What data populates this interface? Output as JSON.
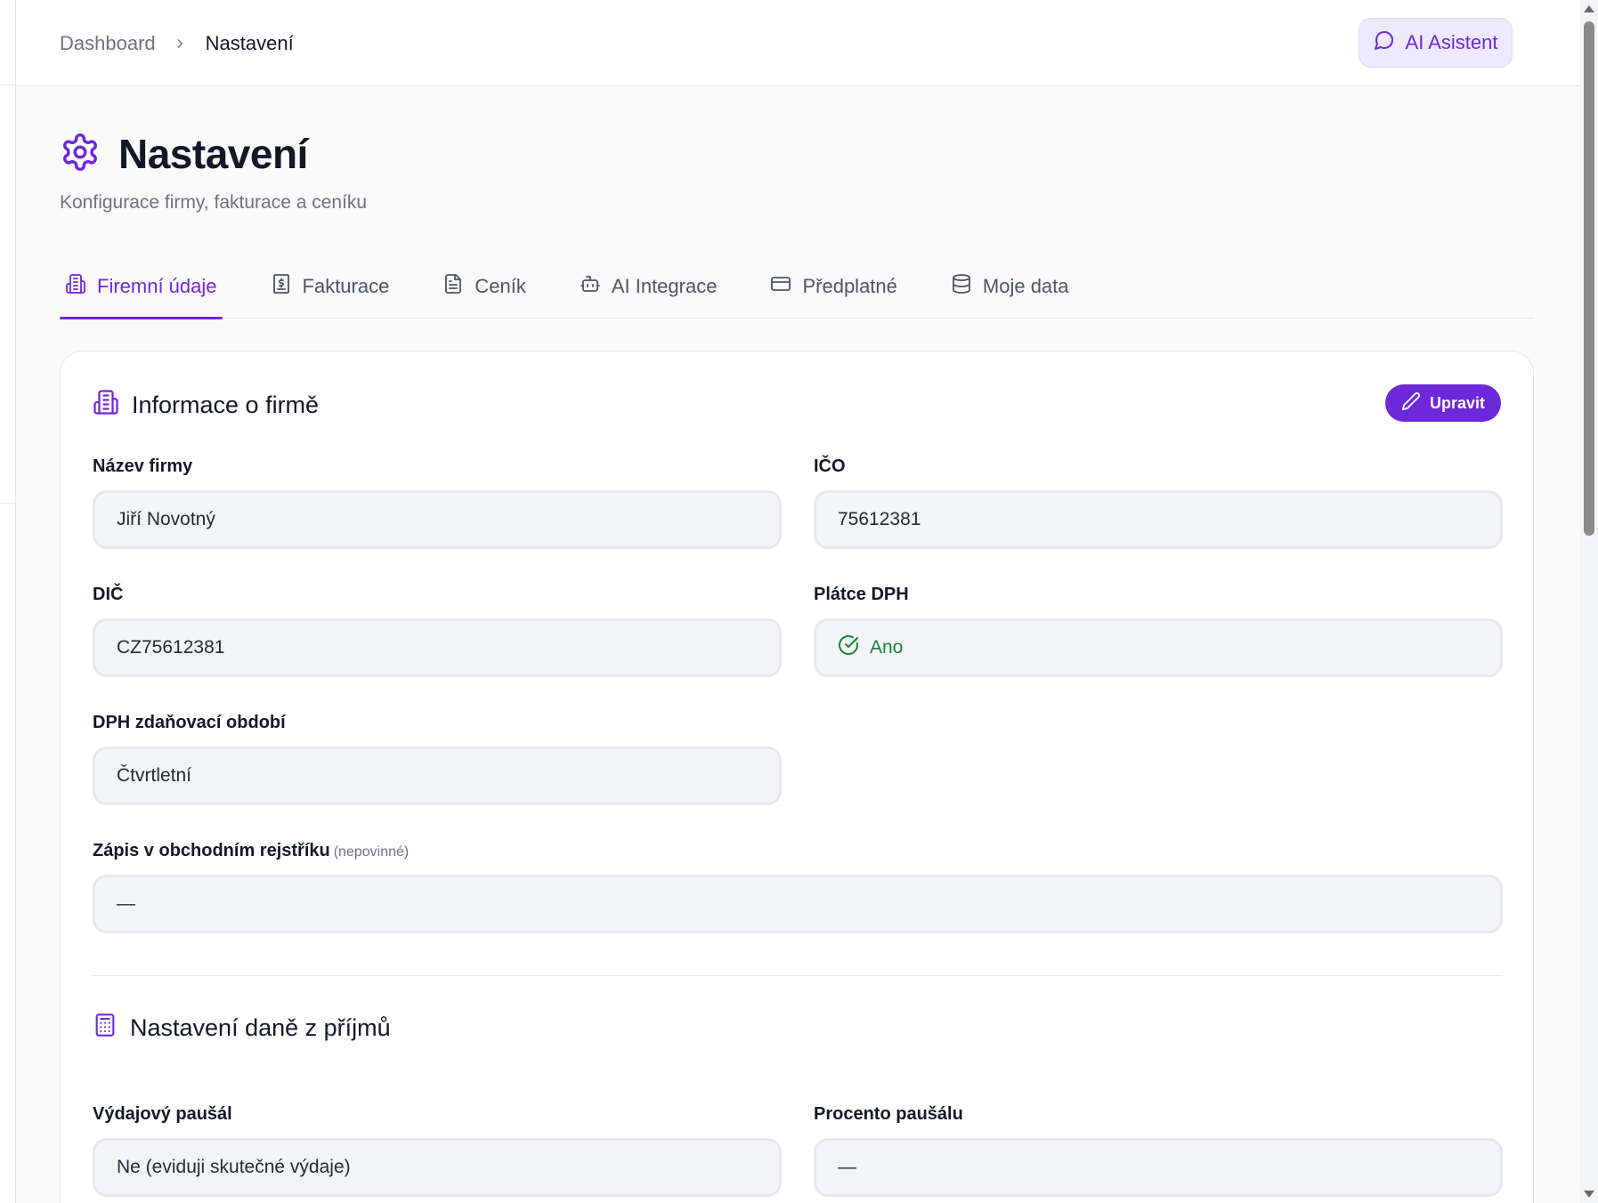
{
  "breadcrumb": {
    "parent": "Dashboard",
    "current": "Nastavení"
  },
  "assistant_button": {
    "label": "AI Asistent"
  },
  "page": {
    "title": "Nastavení",
    "subtitle": "Konfigurace firmy, fakturace a ceníku"
  },
  "tabs": [
    {
      "label": "Firemní údaje",
      "icon": "building-icon",
      "active": true
    },
    {
      "label": "Fakturace",
      "icon": "invoice-icon",
      "active": false
    },
    {
      "label": "Ceník",
      "icon": "document-icon",
      "active": false
    },
    {
      "label": "AI Integrace",
      "icon": "bot-icon",
      "active": false
    },
    {
      "label": "Předplatné",
      "icon": "credit-card-icon",
      "active": false
    },
    {
      "label": "Moje data",
      "icon": "database-icon",
      "active": false
    }
  ],
  "company_section": {
    "title": "Informace o firmě",
    "edit_label": "Upravit",
    "fields": {
      "name": {
        "label": "Název firmy",
        "value": "Jiří Novotný"
      },
      "ico": {
        "label": "IČO",
        "value": "75612381"
      },
      "dic": {
        "label": "DIČ",
        "value": "CZ75612381"
      },
      "vat_payer": {
        "label": "Plátce DPH",
        "value": "Ano"
      },
      "vat_period": {
        "label": "DPH zdaňovací období",
        "value": "Čtvrtletní"
      },
      "registry": {
        "label": "Zápis v obchodním rejstříku",
        "optional": "(nepovinné)",
        "value": "—"
      }
    }
  },
  "tax_section": {
    "title": "Nastavení daně z příjmů",
    "fields": {
      "flat_rate": {
        "label": "Výdajový paušál",
        "value": "Ne (eviduji skutečné výdaje)"
      },
      "flat_percent": {
        "label": "Procento paušálu",
        "value": "—"
      }
    }
  },
  "colors": {
    "accent": "#6d28d9",
    "success": "#15803d"
  }
}
